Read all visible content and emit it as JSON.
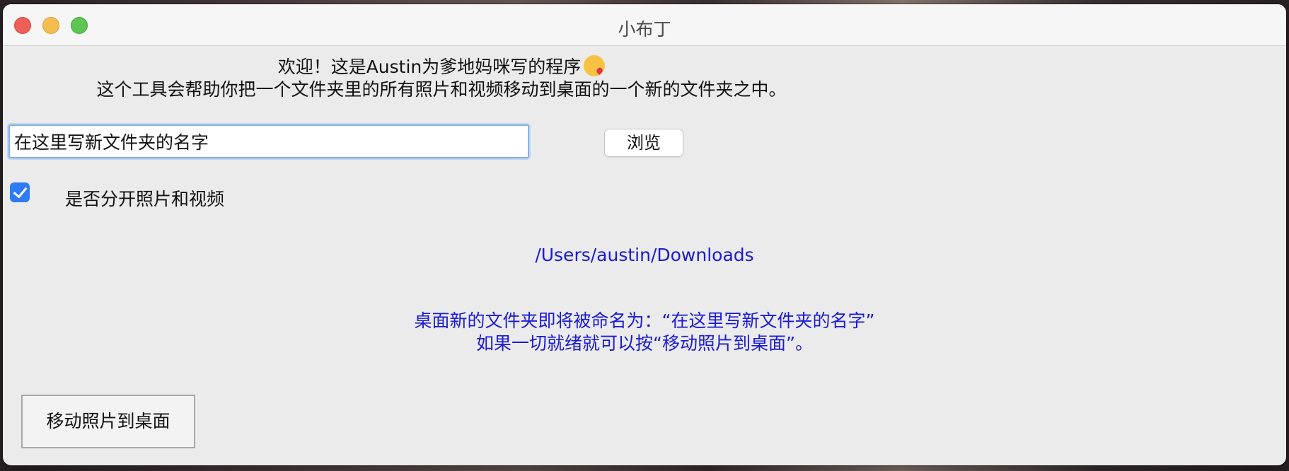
{
  "window": {
    "title": "小布丁"
  },
  "intro": {
    "line1": "欢迎！这是Austin为爹地妈咪写的程序",
    "line1_emoji": "kissing-face-emoji",
    "line2": "这个工具会帮助你把一个文件夹里的所有照片和视频移动到桌面的一个新的文件夹之中。"
  },
  "folder_name_input": {
    "value": "在这里写新文件夹的名字"
  },
  "browse_button": {
    "label": "浏览"
  },
  "separate_checkbox": {
    "checked": true,
    "label": "是否分开照片和视频"
  },
  "selected_path": "/Users/austin/Downloads",
  "status": {
    "line1": "桌面新的文件夹即将被命名为：“在这里写新文件夹的名字”",
    "line2": "如果一切就绪就可以按“移动照片到桌面”。"
  },
  "move_button": {
    "label": "移动照片到桌面"
  },
  "colors": {
    "accent_blue": "#2f7bf5",
    "info_text": "#1a1ad6",
    "close": "#ee5f57",
    "minimize": "#f5bd4f",
    "maximize": "#5ec454"
  }
}
